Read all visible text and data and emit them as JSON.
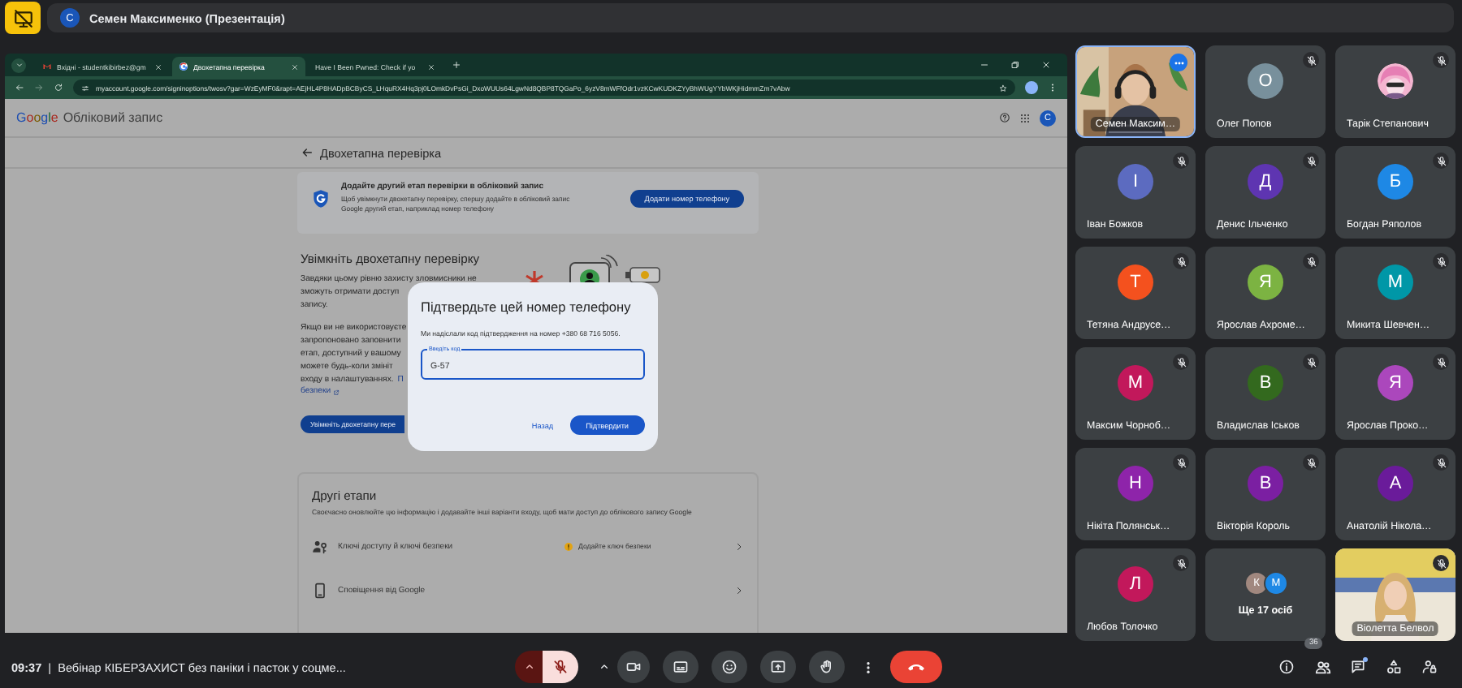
{
  "presenter_bar": {
    "avatar_initial": "С",
    "title": "Семен Максименко (Презентація)"
  },
  "browser": {
    "tabs": [
      {
        "title": "Вхідні - studentkibirbez@gm",
        "selected": false,
        "kind": "mail"
      },
      {
        "title": "Двохетапна перевірка",
        "selected": true,
        "kind": "google"
      },
      {
        "title": "Have I Been Pwned: Check if yo",
        "selected": false,
        "kind": "blank"
      }
    ],
    "url": "myaccount.google.com/signinoptions/twosv?gar=WzEyMF0&rapt=AEjHL4P8HADpBCByCS_LHquRX4Hq3pj0LOmkDvPsGi_DxoWUUs64LgwNd8QBP8TQGaPo_6yzV8mWFfOdr1vzKCwKUDKZYyBhWUgYYbWKjHidmmZm7vAbw"
  },
  "page": {
    "brand": "Google",
    "product": "Обліковий запис",
    "account_initial": "С",
    "heading": "Двохетапна перевірка",
    "banner": {
      "title": "Додайте другий етап перевірки в обліковий запис",
      "text": "Щоб увімкнути двохетапну перевірку, спершу додайте в обліковий запис Google другий етап, наприклад номер телефону",
      "button": "Додати номер телефону"
    },
    "intro": {
      "title": "Увімкніть двохетапну перевірку",
      "paragraph_1": [
        "Завдяки цьому рівню захисту зловмисники не",
        "зможуть отримати доступ",
        "запису."
      ],
      "paragraph_2": [
        "Якщо ви не використовуєте",
        "запропоновано заповнити",
        "етап, доступний у вашому",
        "можете будь-коли змініт",
        "входу в налаштуваннях."
      ],
      "link_parts": [
        "П",
        "безпеки"
      ],
      "button": "Увімкніть двохетапну пере"
    },
    "other_steps": {
      "title": "Другі етапи",
      "text": "Своєчасно оновлюйте цю інформацію і додавайте інші варіанти входу, щоб мати доступ до облікового запису Google",
      "rows": [
        {
          "kind": "passkey",
          "label": "Ключі доступу й ключі безпеки",
          "status": "Додайте ключ безпеки"
        },
        {
          "kind": "phone",
          "label": "Сповіщення від Google"
        }
      ]
    }
  },
  "dialog": {
    "title": "Підтвердьте цей номер телефону",
    "text": "Ми надіслали код підтвердження на номер +380 68 716 5056.",
    "field_label": "Введіть код",
    "field_value": "G-57",
    "back_button": "Назад",
    "confirm_button": "Підтвердити"
  },
  "participants": [
    {
      "kind": "video",
      "name": "Семен Максим…",
      "muted": false,
      "highlighted": true,
      "options_button": true
    },
    {
      "kind": "avatar",
      "name": "Олег Попов",
      "initial": "О",
      "color": "#78909c",
      "muted": true,
      "highlighted": false,
      "options_button": false
    },
    {
      "name": "Тарік Степанович",
      "muted": true,
      "highlighted": false,
      "options_button": false
    },
    {
      "kind": "avatar",
      "name": "Іван Божков",
      "initial": "І",
      "color": "#5c6bc0",
      "muted": true,
      "highlighted": false,
      "options_button": false
    },
    {
      "kind": "avatar",
      "name": "Денис Ільченко",
      "initial": "Д",
      "color": "#5e35b1",
      "muted": true,
      "highlighted": false,
      "options_button": false
    },
    {
      "kind": "avatar",
      "name": "Богдан Ряполов",
      "initial": "Б",
      "color": "#1e88e5",
      "muted": true,
      "highlighted": false,
      "options_button": false
    },
    {
      "kind": "avatar",
      "name": "Тетяна Андрусе…",
      "initial": "Т",
      "color": "#f4511e",
      "muted": true,
      "highlighted": false,
      "options_button": false
    },
    {
      "kind": "avatar",
      "name": "Ярослав Ахроме…",
      "initial": "Я",
      "color": "#7cb342",
      "muted": true,
      "highlighted": false,
      "options_button": false
    },
    {
      "kind": "avatar",
      "name": "Микита Шевчен…",
      "initial": "М",
      "color": "#0097a7",
      "muted": true,
      "highlighted": false,
      "options_button": false
    },
    {
      "kind": "avatar",
      "name": "Максим Чорноб…",
      "initial": "М",
      "color": "#c2185b",
      "muted": true,
      "highlighted": false,
      "options_button": false
    },
    {
      "kind": "avatar",
      "name": "Владислав Іськов",
      "initial": "В",
      "color": "#33691e",
      "muted": true,
      "highlighted": false,
      "options_button": false
    },
    {
      "kind": "avatar",
      "name": "Ярослав Проко…",
      "initial": "Я",
      "color": "#ab47bc",
      "muted": true,
      "highlighted": false,
      "options_button": false
    },
    {
      "kind": "avatar",
      "name": "Нікіта Полянськ…",
      "initial": "Н",
      "color": "#8e24aa",
      "muted": true,
      "highlighted": false,
      "options_button": false
    },
    {
      "kind": "avatar",
      "name": "Вікторія Король",
      "initial": "В",
      "color": "#7b1fa2",
      "muted": true,
      "highlighted": false,
      "options_button": false
    },
    {
      "kind": "avatar",
      "name": "Анатолій Нікола…",
      "initial": "А",
      "color": "#6a1b9a",
      "muted": true,
      "highlighted": false,
      "options_button": false
    },
    {
      "kind": "avatar",
      "name": "Любов Толочко",
      "initial": "Л",
      "color": "#c2185b",
      "muted": true,
      "highlighted": false,
      "options_button": false
    },
    {
      "kind": "more",
      "label": "Ще 17 осіб",
      "avatars": [
        {
          "initial": "К",
          "color": "#a1887f"
        },
        {
          "initial": "М",
          "color": "#1e88e5"
        }
      ]
    },
    {
      "kind": "video",
      "name": "Віолетта Белвол",
      "muted": true,
      "highlighted": false,
      "options_button": false
    }
  ],
  "bottom_bar": {
    "time": "09:37",
    "separator": "|",
    "meeting_title": "Вебінар КІБЕРЗАХИСТ без паніки і пасток у соцме...",
    "mic_muted": true,
    "people_count": "36",
    "chat_unread": true
  }
}
